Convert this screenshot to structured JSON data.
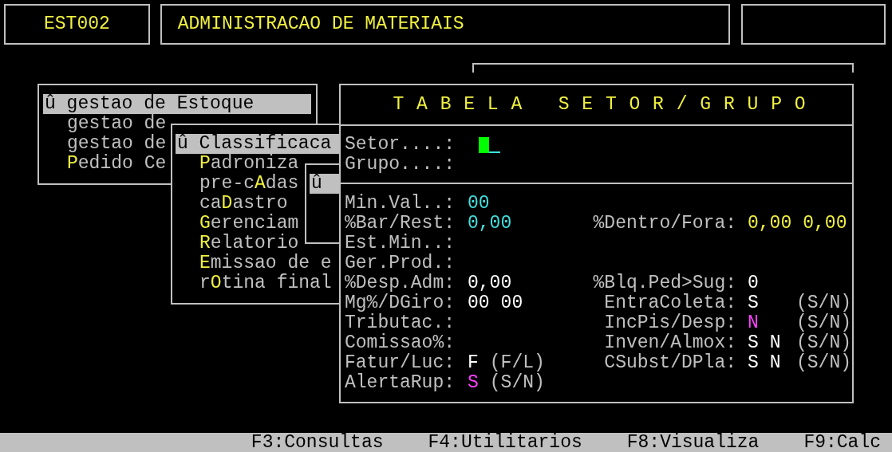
{
  "header": {
    "code": "EST002",
    "title": "ADMINISTRACAO DE MATERIAIS"
  },
  "menus": [
    {
      "items": [
        {
          "selected": true,
          "label": "û gestao de Estoque"
        },
        {
          "selected": false,
          "label": "gestao de"
        },
        {
          "selected": false,
          "label": "gestao de"
        },
        {
          "selected": false,
          "hotkey": "P",
          "after": "edido Ce"
        }
      ]
    },
    {
      "items": [
        {
          "selected": true,
          "label": "û Classificaca"
        },
        {
          "selected": false,
          "hotkey": "P",
          "after": "adroniza"
        },
        {
          "selected": false,
          "before": "pre-c",
          "hotkey": "A",
          "after": "das"
        },
        {
          "selected": false,
          "before": "ca",
          "hotkey": "D",
          "after": "astro"
        },
        {
          "selected": false,
          "hotkey": "G",
          "after": "erenciam"
        },
        {
          "selected": false,
          "hotkey": "R",
          "after": "elatorio"
        },
        {
          "selected": false,
          "hotkey": "E",
          "after": "missao de e"
        },
        {
          "selected": false,
          "before": "r",
          "hotkey": "O",
          "after": "tina final"
        }
      ]
    },
    {
      "items": [
        {
          "selected": true,
          "label": "û"
        }
      ]
    }
  ],
  "form": {
    "title": "T A B E L A   S E T O R / G R U P O",
    "keys": [
      {
        "label": "Setor....:",
        "focused": true
      },
      {
        "label": "Grupo....:",
        "focused": false
      }
    ],
    "rows": [
      {
        "left": {
          "label": "Min.Val..:",
          "values": [
            {
              "text": "00",
              "color": "#40e0e0"
            }
          ]
        }
      },
      {
        "left": {
          "label": "%Bar/Rest:",
          "values": [
            {
              "text": "0,00",
              "color": "#40e0e0"
            }
          ]
        },
        "right": {
          "label": "%Dentro/Fora:",
          "values": [
            {
              "text": "0,00",
              "color": "#f0f040"
            },
            {
              "text": "0,00",
              "color": "#f0f040"
            }
          ]
        }
      },
      {
        "left": {
          "label": "Est.Min..:"
        }
      },
      {
        "left": {
          "label": "Ger.Prod.:"
        }
      },
      {
        "left": {
          "label": "%Desp.Adm:",
          "values": [
            {
              "text": "0,00",
              "color": "#ffffff"
            }
          ]
        },
        "right": {
          "label": "%Blq.Ped>Sug:",
          "values": [
            {
              "text": "0",
              "color": "#ffffff"
            }
          ]
        }
      },
      {
        "left": {
          "label": "Mg%/DGiro:",
          "values": [
            {
              "text": "00",
              "color": "#ffffff"
            },
            {
              "text": "00",
              "color": "#ffffff"
            }
          ]
        },
        "right": {
          "label": "EntraColeta:",
          "values": [
            {
              "text": "S",
              "color": "#ffffff"
            }
          ],
          "hint": "(S/N)"
        }
      },
      {
        "left": {
          "label": "Tributac.:"
        },
        "right": {
          "label": "IncPis/Desp:",
          "values": [
            {
              "text": "N",
              "color": "#ff40ff"
            }
          ],
          "hint": "(S/N)"
        }
      },
      {
        "left": {
          "label": "Comissao%:"
        },
        "right": {
          "label": "Inven/Almox:",
          "values": [
            {
              "text": "S",
              "color": "#ffffff"
            },
            {
              "text": "N",
              "color": "#ffffff"
            }
          ],
          "hint": "(S/N)"
        }
      },
      {
        "left": {
          "label": "Fatur/Luc:",
          "values": [
            {
              "text": "F",
              "color": "#ffffff"
            }
          ],
          "hint": "(F/L)"
        },
        "right": {
          "label": "CSubst/DPla:",
          "values": [
            {
              "text": "S",
              "color": "#ffffff"
            },
            {
              "text": "N",
              "color": "#ffffff"
            }
          ],
          "hint": "(S/N)"
        }
      },
      {
        "left": {
          "label": "AlertaRup:",
          "values": [
            {
              "text": "S",
              "color": "#ff40ff"
            }
          ],
          "hint": "(S/N)"
        }
      }
    ]
  },
  "status_bar": [
    "F3:Consultas",
    "F4:Utilitarios",
    "F8:Visualiza",
    "F9:Calc"
  ]
}
